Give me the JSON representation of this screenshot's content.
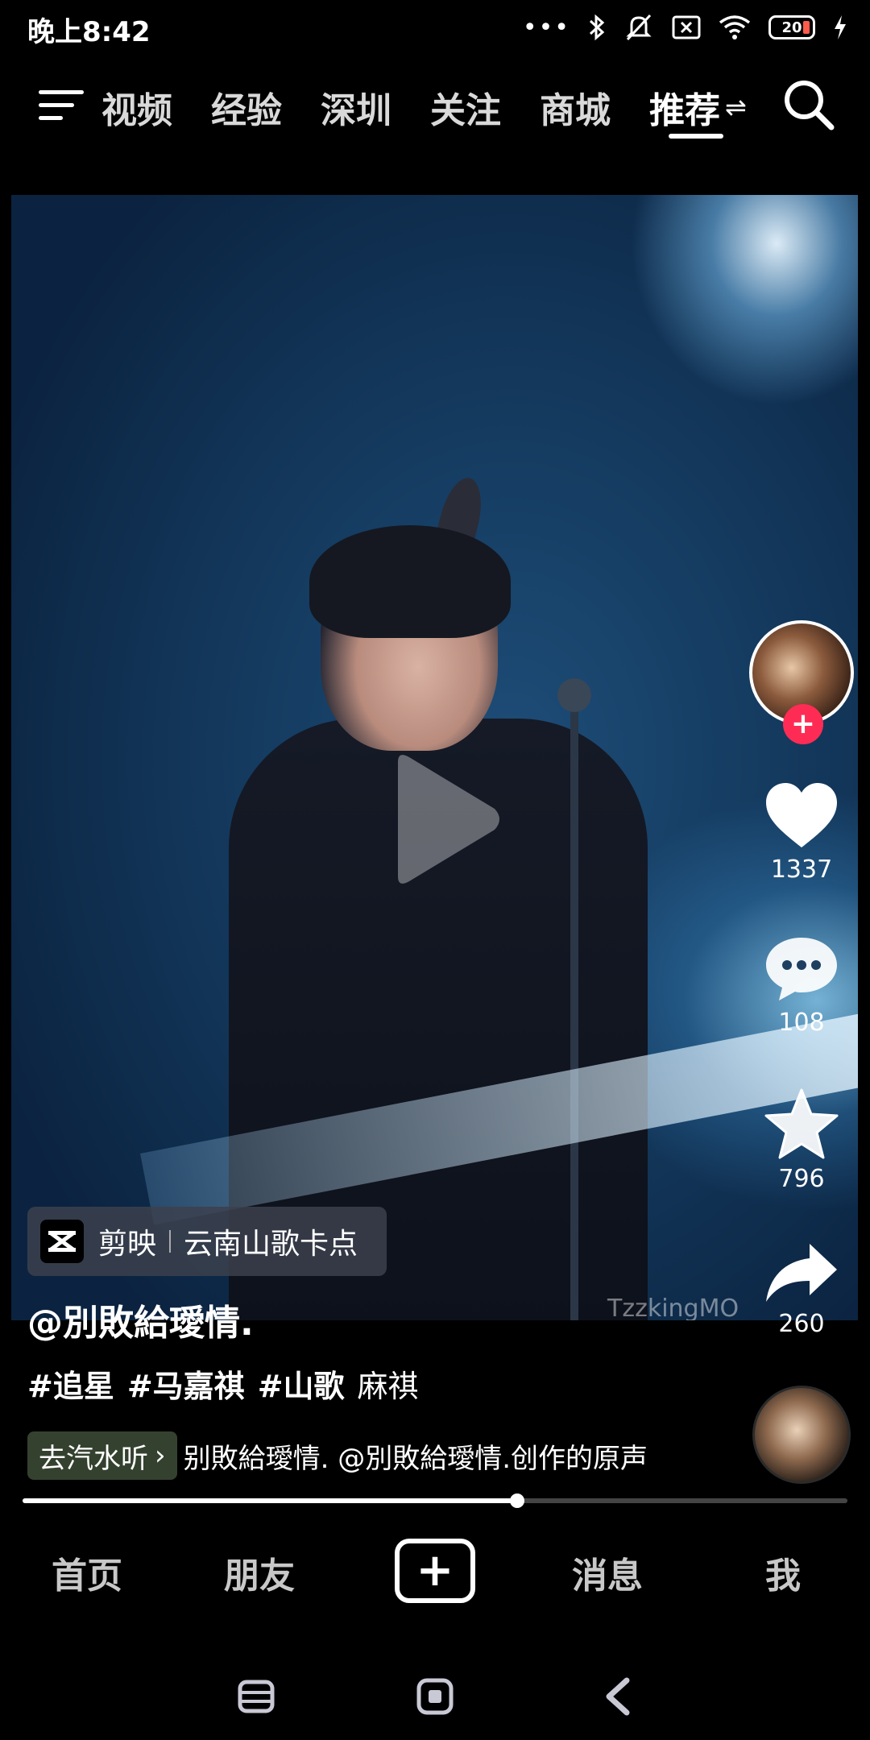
{
  "status_bar": {
    "time": "晚上8:42",
    "battery": "20",
    "icons": [
      "dots-icon",
      "bluetooth-icon",
      "mute-icon",
      "sim-x-icon",
      "wifi-icon",
      "battery-icon",
      "charging-icon"
    ]
  },
  "top_nav": {
    "tabs": [
      {
        "label": "视频"
      },
      {
        "label": "经验"
      },
      {
        "label": "深圳"
      },
      {
        "label": "关注"
      },
      {
        "label": "商城"
      },
      {
        "label": "推荐"
      }
    ],
    "active_tab": "推荐"
  },
  "video": {
    "watermark": "TzzkingMO",
    "progress": 0.6
  },
  "rail": {
    "likes": "1337",
    "comments": "108",
    "favorites": "796",
    "shares": "260",
    "follow_symbol": "+"
  },
  "info": {
    "capcut_brand": "剪映",
    "capcut_template": "云南山歌卡点",
    "author": "@別敗給璦情.",
    "hashtags": [
      "#追星",
      "#马嘉祺",
      "#山歌"
    ],
    "plain_tag": "麻祺",
    "music_button": "去汽水听",
    "music_text": "别敗給璦情.    @別敗給璦情.创作的原声"
  },
  "bottom_nav": {
    "home": "首页",
    "friends": "朋友",
    "add": "+",
    "messages": "消息",
    "me": "我"
  },
  "colors": {
    "accent": "#fe2c55",
    "background": "#000000",
    "music_chip": "#35412f"
  }
}
